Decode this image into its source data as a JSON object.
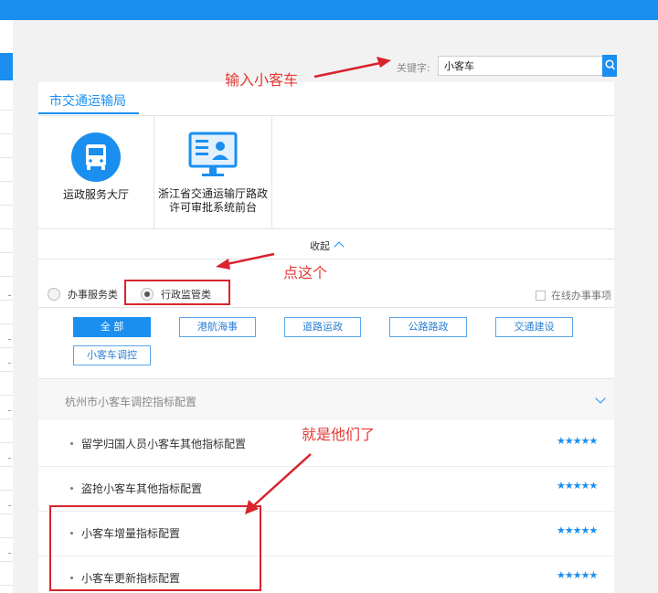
{
  "search": {
    "label": "关键字:",
    "value": "小客车"
  },
  "tabs": [
    {
      "label": "市交通运输局"
    }
  ],
  "services": [
    {
      "label": "运政服务大厅",
      "icon": "bus-icon"
    },
    {
      "label": "浙江省交通运输厅路政许可审批系统前台",
      "icon": "monitor-id-card-icon"
    }
  ],
  "collapse_label": "收起",
  "filters": {
    "radio_service": "办事服务类",
    "radio_admin": "行政监管类",
    "selected": "行政监管类",
    "online_checkbox": "在线办事事项"
  },
  "categories": [
    {
      "label": "全 部",
      "active": true
    },
    {
      "label": "港航海事"
    },
    {
      "label": "道路运政"
    },
    {
      "label": "公路路政"
    },
    {
      "label": "交通建设"
    },
    {
      "label": "小客车调控"
    }
  ],
  "list": {
    "header": "杭州市小客车调控指标配置",
    "items": [
      {
        "title": "留学归国人员小客车其他指标配置",
        "stars": "★★★★★"
      },
      {
        "title": "盗抢小客车其他指标配置",
        "stars": "★★★★★"
      },
      {
        "title": "小客车增量指标配置",
        "stars": "★★★★★"
      },
      {
        "title": "小客车更新指标配置",
        "stars": "★★★★★"
      }
    ]
  },
  "annotations": {
    "type_here": "输入小客车",
    "click_this": "点这个",
    "these_ones": "就是他们了"
  },
  "colors": {
    "accent": "#1a8ff0",
    "annotation": "#e53935"
  }
}
